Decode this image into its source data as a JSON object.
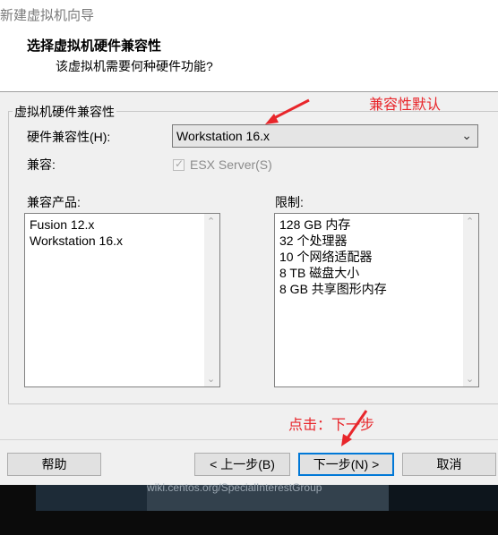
{
  "window": {
    "title": "新建虚拟机向导",
    "header_title": "选择虚拟机硬件兼容性",
    "header_subtitle": "该虚拟机需要何种硬件功能?"
  },
  "group": {
    "label": "虚拟机硬件兼容性",
    "hw_label": "硬件兼容性(H):",
    "hw_value": "Workstation 16.x",
    "compat_label": "兼容:",
    "esx_label": "ESX Server(S)",
    "esx_checked": true,
    "products_label": "兼容产品:",
    "products": [
      "Fusion 12.x",
      "Workstation 16.x"
    ],
    "limits_label": "限制:",
    "limits": [
      "128 GB 内存",
      "32 个处理器",
      "10 个网络适配器",
      "8 TB 磁盘大小",
      "8 GB 共享图形内存"
    ]
  },
  "buttons": {
    "help": "帮助",
    "back": "< 上一步(B)",
    "next": "下一步(N) >",
    "cancel": "取消"
  },
  "annotations": {
    "compat_default": "兼容性默认",
    "click_next": "点击：下一步"
  },
  "background": {
    "partial_url": "wiki.centos.org/SpecialInterestGroup"
  },
  "colors": {
    "annotation": "#e8262b",
    "primary_button_border": "#0078d7"
  }
}
